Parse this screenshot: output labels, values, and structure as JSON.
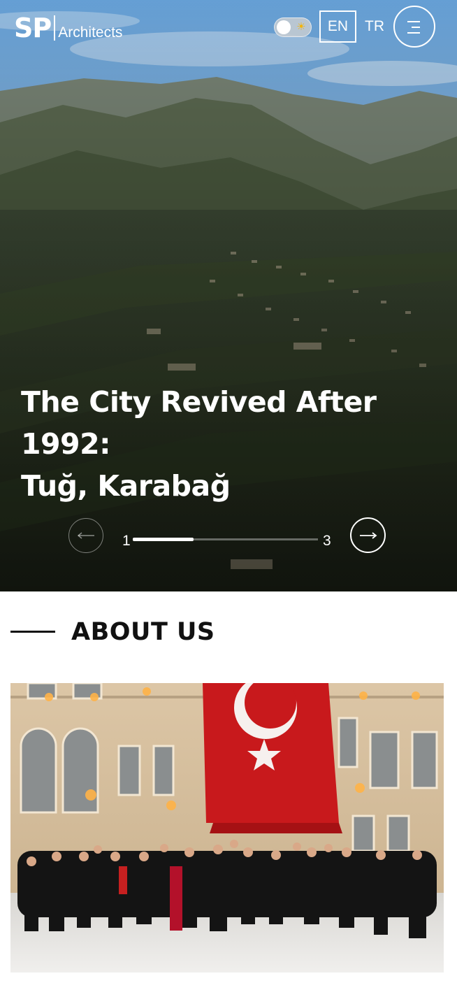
{
  "header": {
    "logo_sp": "SP",
    "logo_text": "Architects",
    "theme_toggle_icon": "sun-icon",
    "lang_en": "EN",
    "lang_tr": "TR",
    "menu_icon": "menu-icon"
  },
  "hero": {
    "title_line1": "The City Revived After 1992:",
    "title_line2": "Tuğ, Karabağ",
    "slide_current": "1",
    "slide_total": "3",
    "progress_fraction": 0.33,
    "prev_icon": "arrow-left-icon",
    "next_icon": "arrow-right-icon"
  },
  "about": {
    "title": "ABOUT US"
  },
  "colors": {
    "accent": "#f5b400",
    "text_dark": "#111111",
    "flag_red": "#c8191c"
  }
}
